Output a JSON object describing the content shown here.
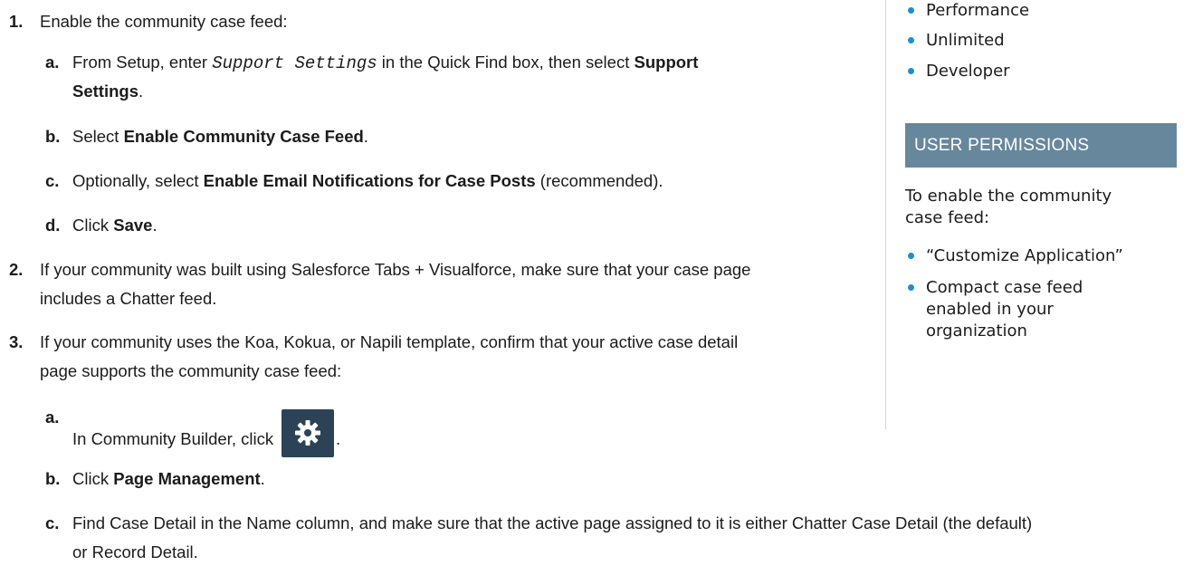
{
  "steps": {
    "s1": {
      "num": "1.",
      "text": "Enable the community case feed:",
      "a": {
        "letter": "a.",
        "pre": "From Setup, enter ",
        "code": "Support Settings",
        "mid": " in the Quick Find box, then select ",
        "bold1": "Support",
        "bold2": "Settings",
        "post": "."
      },
      "b": {
        "letter": "b.",
        "pre": "Select ",
        "bold": "Enable Community Case Feed",
        "post": "."
      },
      "c": {
        "letter": "c.",
        "pre": "Optionally, select ",
        "bold": "Enable Email Notifications for Case Posts",
        "post": " (recommended)."
      },
      "d": {
        "letter": "d.",
        "pre": "Click ",
        "bold": "Save",
        "post": "."
      }
    },
    "s2": {
      "num": "2.",
      "line1": "If your community was built using Salesforce Tabs + Visualforce, make sure that your case page",
      "line2": "includes a Chatter feed."
    },
    "s3": {
      "num": "3.",
      "line1": "If your community uses the Koa, Kokua, or Napili template, confirm that your active case detail",
      "line2": "page supports the community case feed:",
      "a": {
        "letter": "a.",
        "pre": "In Community Builder, click ",
        "post": "."
      },
      "b": {
        "letter": "b.",
        "pre": "Click ",
        "bold": "Page Management",
        "post": "."
      },
      "c": {
        "letter": "c.",
        "line1": "Find Case Detail in the Name column, and make sure that the active page assigned to it is either Chatter Case Detail (the default)",
        "line2": "or Record Detail."
      }
    }
  },
  "sidebar": {
    "editions": [
      "Performance",
      "Unlimited",
      "Developer"
    ],
    "permissions_header": "USER PERMISSIONS",
    "perm_intro_1": "To enable the community",
    "perm_intro_2": "case feed:",
    "perms": [
      {
        "lines": [
          "“Customize Application”"
        ]
      },
      {
        "lines": [
          "Compact case feed",
          "enabled in your",
          "organization"
        ]
      }
    ]
  },
  "colors": {
    "bullet": "#1c8fd0",
    "header_bg": "#67879c",
    "gear_bg": "#2c4357"
  },
  "icons": {
    "setup_gear": "gear-icon"
  }
}
